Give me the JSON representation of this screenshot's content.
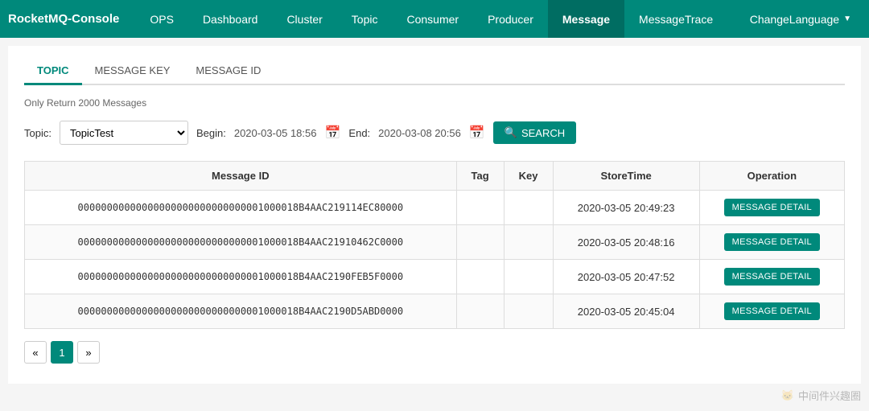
{
  "brand": "RocketMQ-Console",
  "nav": {
    "items": [
      {
        "label": "OPS",
        "active": false
      },
      {
        "label": "Dashboard",
        "active": false
      },
      {
        "label": "Cluster",
        "active": false
      },
      {
        "label": "Topic",
        "active": false
      },
      {
        "label": "Consumer",
        "active": false
      },
      {
        "label": "Producer",
        "active": false
      },
      {
        "label": "Message",
        "active": true
      },
      {
        "label": "MessageTrace",
        "active": false
      }
    ],
    "lang_label": "ChangeLanguage",
    "lang_caret": "▼"
  },
  "tabs": [
    {
      "label": "TOPIC",
      "active": true
    },
    {
      "label": "MESSAGE KEY",
      "active": false
    },
    {
      "label": "MESSAGE ID",
      "active": false
    }
  ],
  "info_text": "Only Return 2000 Messages",
  "search": {
    "topic_label": "Topic:",
    "topic_value": "TopicTest",
    "begin_label": "Begin:",
    "begin_value": "2020-03-05 18:56",
    "end_label": "End:",
    "end_value": "2020-03-08 20:56",
    "button_label": "SEARCH",
    "search_icon": "🔍"
  },
  "table": {
    "columns": [
      "Message ID",
      "Tag",
      "Key",
      "StoreTime",
      "Operation"
    ],
    "rows": [
      {
        "message_id": "00000000000000000000000000000001000018B4AAC219114EC80000",
        "tag": "",
        "key": "",
        "store_time": "2020-03-05 20:49:23",
        "btn_label": "MESSAGE DETAIL"
      },
      {
        "message_id": "00000000000000000000000000000001000018B4AAC21910462C0000",
        "tag": "",
        "key": "",
        "store_time": "2020-03-05 20:48:16",
        "btn_label": "MESSAGE DETAIL"
      },
      {
        "message_id": "00000000000000000000000000000001000018B4AAC2190FEB5F0000",
        "tag": "",
        "key": "",
        "store_time": "2020-03-05 20:47:52",
        "btn_label": "MESSAGE DETAIL"
      },
      {
        "message_id": "00000000000000000000000000000001000018B4AAC2190D5ABD0000",
        "tag": "",
        "key": "",
        "store_time": "2020-03-05 20:45:04",
        "btn_label": "MESSAGE DETAIL"
      }
    ]
  },
  "pagination": {
    "prev": "«",
    "current": "1",
    "next": "»"
  },
  "watermark": "中间件兴趣圈"
}
